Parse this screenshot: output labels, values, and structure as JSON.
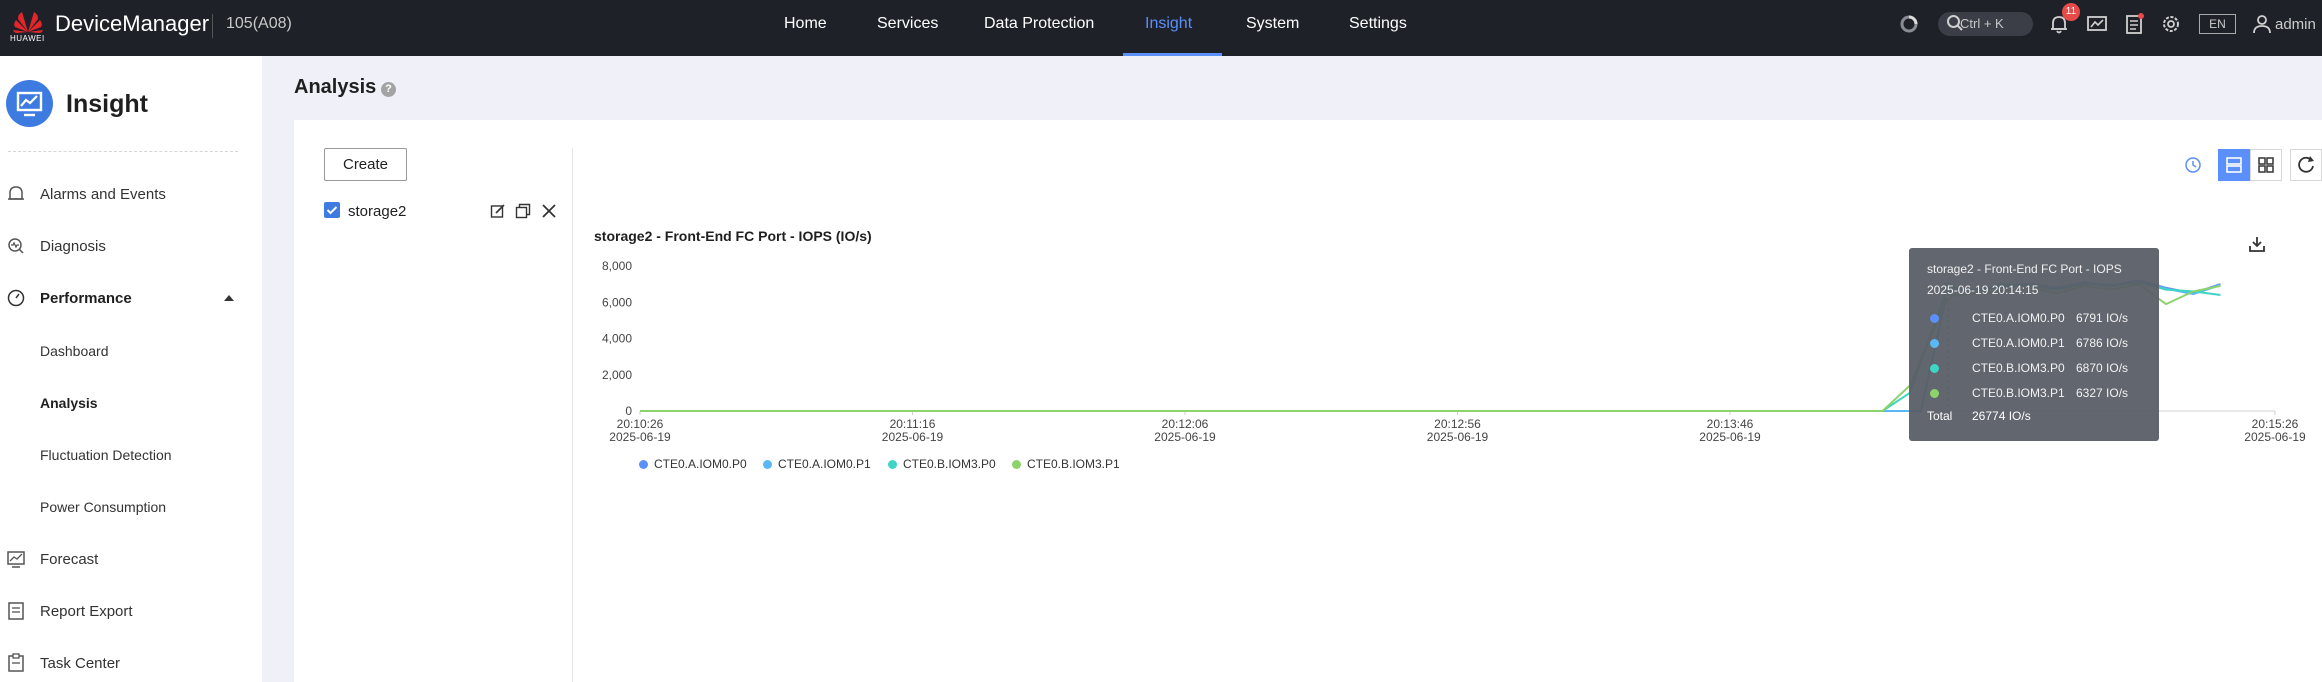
{
  "topbar": {
    "brand": "HUAWEI",
    "app_name": "DeviceManager",
    "device": "105(A08)",
    "nav": [
      {
        "label": "Home",
        "active": false
      },
      {
        "label": "Services",
        "active": false
      },
      {
        "label": "Data Protection",
        "active": false
      },
      {
        "label": "Insight",
        "active": true
      },
      {
        "label": "System",
        "active": false
      },
      {
        "label": "Settings",
        "active": false
      }
    ],
    "search_shortcut": "Ctrl + K",
    "notification_count": "11",
    "language": "EN",
    "user": "admin",
    "icons": [
      "spinner-icon",
      "search-icon",
      "bell-icon",
      "monitor-chart-icon",
      "clipboard-icon",
      "gear-icon",
      "user-icon"
    ]
  },
  "sidebar": {
    "title": "Insight",
    "items": [
      {
        "label": "Alarms and Events",
        "icon": "bell-icon"
      },
      {
        "label": "Diagnosis",
        "icon": "diagnosis-icon"
      },
      {
        "label": "Performance",
        "icon": "gauge-icon",
        "expanded": true
      },
      {
        "label": "Dashboard",
        "sub": true
      },
      {
        "label": "Analysis",
        "sub": true,
        "active": true
      },
      {
        "label": "Fluctuation Detection",
        "sub": true
      },
      {
        "label": "Power Consumption",
        "sub": true
      },
      {
        "label": "Forecast",
        "icon": "forecast-icon"
      },
      {
        "label": "Report Export",
        "icon": "report-icon"
      },
      {
        "label": "Task Center",
        "icon": "task-icon"
      }
    ]
  },
  "main": {
    "title": "Analysis",
    "help": "?",
    "create_label": "Create",
    "objects": [
      {
        "name": "storage2",
        "checked": true
      }
    ]
  },
  "chart_data": {
    "type": "line",
    "title": "storage2 - Front-End FC Port - IOPS (IO/s)",
    "ylim": [
      0,
      8000
    ],
    "yticks": [
      "8,000",
      "6,000",
      "4,000",
      "2,000",
      "0"
    ],
    "xticks": [
      {
        "time": "20:10:26",
        "date": "2025-06-19"
      },
      {
        "time": "20:11:16",
        "date": "2025-06-19"
      },
      {
        "time": "20:12:06",
        "date": "2025-06-19"
      },
      {
        "time": "20:12:56",
        "date": "2025-06-19"
      },
      {
        "time": "20:13:46",
        "date": "2025-06-19"
      },
      {
        "time": "20:15:26",
        "date": "2025-06-19"
      }
    ],
    "x_seconds_range": [
      0,
      300
    ],
    "series": [
      {
        "name": "CTE0.A.IOM0.P0",
        "color": "#5b8ff9",
        "x": [
          0,
          230,
          235,
          240,
          245,
          250,
          255,
          260,
          265,
          270,
          275,
          280,
          285,
          290
        ],
        "y": [
          0,
          0,
          0,
          6791,
          6700,
          6900,
          7000,
          6800,
          7100,
          6900,
          7200,
          6800,
          6500,
          7000
        ]
      },
      {
        "name": "CTE0.A.IOM0.P1",
        "color": "#5ab8f5",
        "x": [
          0,
          230,
          235,
          240,
          245,
          250,
          255,
          260,
          265,
          270,
          275,
          280,
          285,
          290
        ],
        "y": [
          0,
          0,
          0,
          6786,
          6650,
          6850,
          6950,
          6750,
          7050,
          6880,
          7150,
          6750,
          6450,
          6950
        ]
      },
      {
        "name": "CTE0.B.IOM3.P0",
        "color": "#3fd4c4",
        "x": [
          0,
          228,
          233,
          240,
          245,
          250,
          255,
          260,
          265,
          270,
          275,
          280,
          285,
          290
        ],
        "y": [
          0,
          0,
          1000,
          6870,
          6600,
          7000,
          6900,
          6700,
          7000,
          6950,
          7100,
          6700,
          6600,
          6400
        ]
      },
      {
        "name": "CTE0.B.IOM3.P1",
        "color": "#8cd36b",
        "x": [
          0,
          228,
          233,
          240,
          245,
          250,
          255,
          260,
          265,
          270,
          275,
          280,
          285,
          290
        ],
        "y": [
          0,
          0,
          1400,
          6327,
          6500,
          6600,
          6800,
          6500,
          6900,
          6700,
          7000,
          5900,
          6600,
          6900
        ]
      }
    ],
    "tooltip": {
      "title": "storage2 - Front-End FC Port - IOPS",
      "time": "2025-06-19 20:14:15",
      "rows": [
        {
          "name": "CTE0.A.IOM0.P0",
          "value": "6791 IO/s",
          "color": "#5b8ff9"
        },
        {
          "name": "CTE0.A.IOM0.P1",
          "value": "6786 IO/s",
          "color": "#5ab8f5"
        },
        {
          "name": "CTE0.B.IOM3.P0",
          "value": "6870 IO/s",
          "color": "#3fd4c4"
        },
        {
          "name": "CTE0.B.IOM3.P1",
          "value": "6327 IO/s",
          "color": "#8cd36b"
        }
      ],
      "total_label": "Total",
      "total_value": "26774 IO/s"
    }
  }
}
